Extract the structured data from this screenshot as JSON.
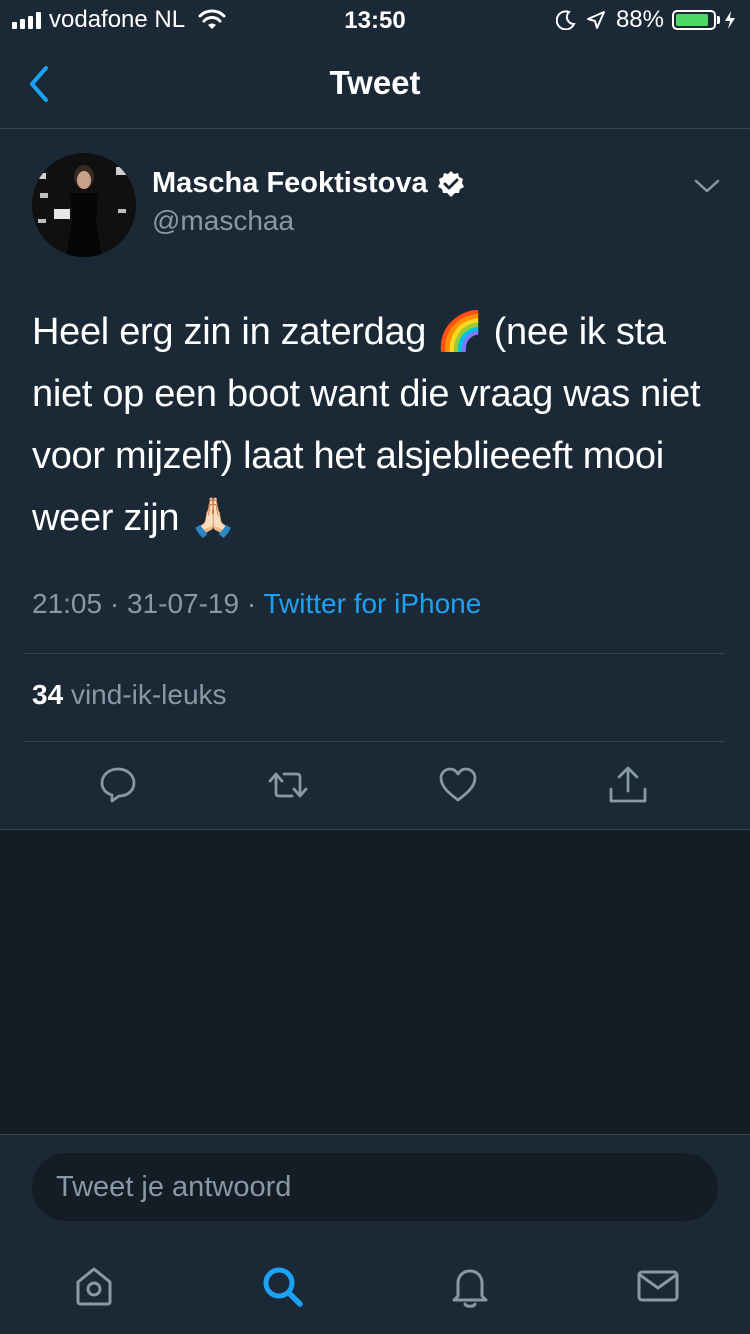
{
  "status_bar": {
    "carrier": "vodafone NL",
    "time": "13:50",
    "battery_percent": "88%",
    "battery_level": 0.88,
    "icons": [
      "signal-icon",
      "wifi-icon",
      "moon-icon",
      "location-arrow-icon",
      "battery-icon",
      "charging-bolt-icon"
    ]
  },
  "nav": {
    "title": "Tweet",
    "back_icon": "chevron-left-icon"
  },
  "tweet": {
    "author_name": "Mascha Feoktistova",
    "author_handle": "@maschaa",
    "verified": true,
    "text": "Heel erg zin in zaterdag 🌈 (nee ik sta niet op een boot want die vraag was niet voor mijzelf) laat het alsjeblieeeft mooi weer zijn 🙏🏻",
    "time": "21:05",
    "date": "31-07-19",
    "separator": "·",
    "source": "Twitter for iPhone",
    "likes_count": "34",
    "likes_label": "vind-ik-leuks",
    "actions": [
      "reply-icon",
      "retweet-icon",
      "like-icon",
      "share-icon"
    ]
  },
  "reply": {
    "placeholder": "Tweet je antwoord"
  },
  "tab_bar": {
    "active": "search",
    "tabs": [
      "home-icon",
      "search-icon",
      "notifications-icon",
      "messages-icon"
    ]
  },
  "colors": {
    "background": "#141d26",
    "surface": "#1b2836",
    "accent": "#1da1f2",
    "muted": "#8899a6",
    "border": "#38444d",
    "battery": "#4cd964"
  }
}
